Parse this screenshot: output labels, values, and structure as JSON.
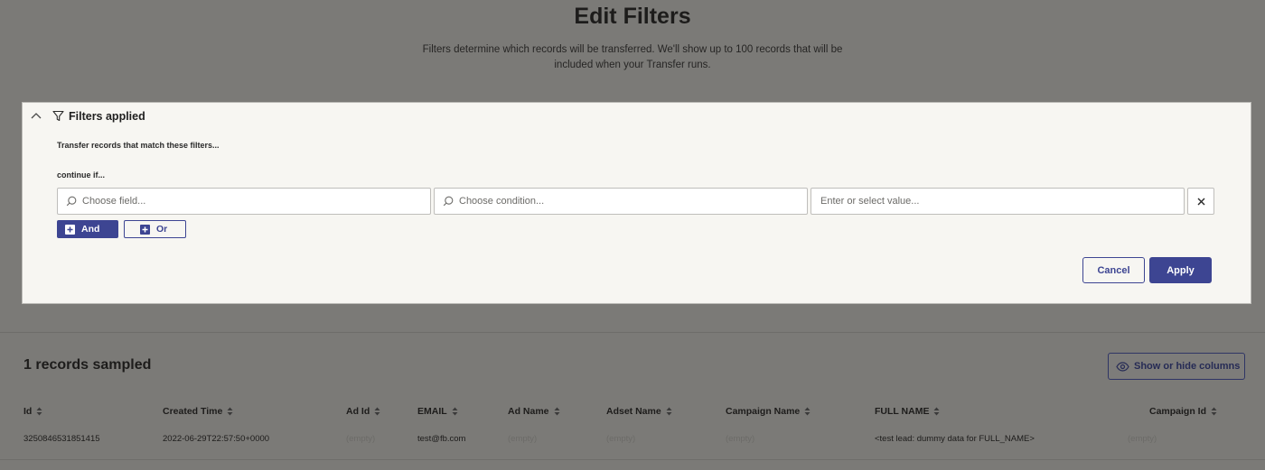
{
  "page": {
    "title": "Edit Filters",
    "subtitle_line1": "Filters determine which records will be transferred. We'll show up to 100 records that will be",
    "subtitle_line2": "included when your Transfer runs."
  },
  "filter_panel": {
    "title": "Filters applied",
    "intro": "Transfer records that match these filters...",
    "continue_label": "continue if...",
    "field_placeholder": "Choose field...",
    "condition_placeholder": "Choose condition...",
    "value_placeholder": "Enter or select value...",
    "and_label": "And",
    "or_label": "Or",
    "cancel_label": "Cancel",
    "apply_label": "Apply"
  },
  "records": {
    "title": "1 records sampled",
    "columns_button": "Show or hide columns",
    "columns": [
      "Id",
      "Created Time",
      "Ad Id",
      "EMAIL",
      "Ad Name",
      "Adset Name",
      "Campaign Name",
      "FULL NAME",
      "Campaign Id"
    ],
    "rows": [
      [
        "3250846531851415",
        "2022-06-29T22:57:50+0000",
        "(empty)",
        "test@fb.com",
        "(empty)",
        "(empty)",
        "(empty)",
        "<test lead: dummy data for FULL_NAME>",
        "(empty)"
      ]
    ]
  },
  "colors": {
    "primary": "#3d4592",
    "overlay": "#7b7a77",
    "panel_bg": "#f7f6f2"
  },
  "icons": [
    "chevron-up-icon",
    "funnel-icon",
    "search-icon",
    "close-icon",
    "plus-icon",
    "eye-icon",
    "sort-icon"
  ]
}
